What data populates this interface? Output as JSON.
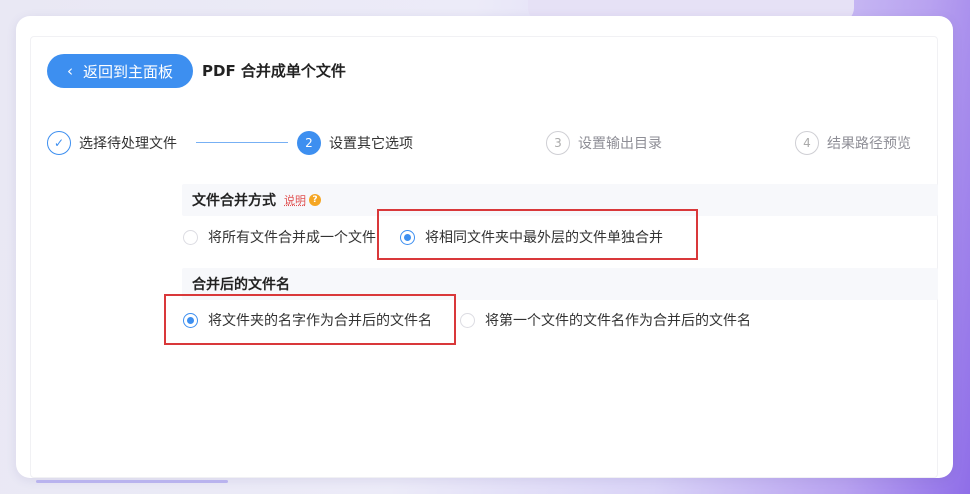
{
  "header": {
    "back_label": "返回到主面板",
    "back_icon": "chevron-left-icon",
    "title": "PDF 合并成单个文件"
  },
  "steps": [
    {
      "number": "✓",
      "label": "选择待处理文件",
      "state": "done"
    },
    {
      "number": "2",
      "label": "设置其它选项",
      "state": "active"
    },
    {
      "number": "3",
      "label": "设置输出目录",
      "state": "todo"
    },
    {
      "number": "4",
      "label": "结果路径预览",
      "state": "todo"
    }
  ],
  "merge_mode": {
    "title": "文件合并方式",
    "help_label": "说明",
    "help_icon": "?",
    "options": [
      {
        "label": "将所有文件合并成一个文件",
        "checked": false
      },
      {
        "label": "将相同文件夹中最外层的文件单独合并",
        "checked": true
      }
    ]
  },
  "file_name": {
    "title": "合并后的文件名",
    "options": [
      {
        "label": "将文件夹的名字作为合并后的文件名",
        "checked": true
      },
      {
        "label": "将第一个文件的文件名作为合并后的文件名",
        "checked": false
      }
    ]
  },
  "colors": {
    "accent": "#3d8ff0",
    "highlight": "#d9383a"
  }
}
